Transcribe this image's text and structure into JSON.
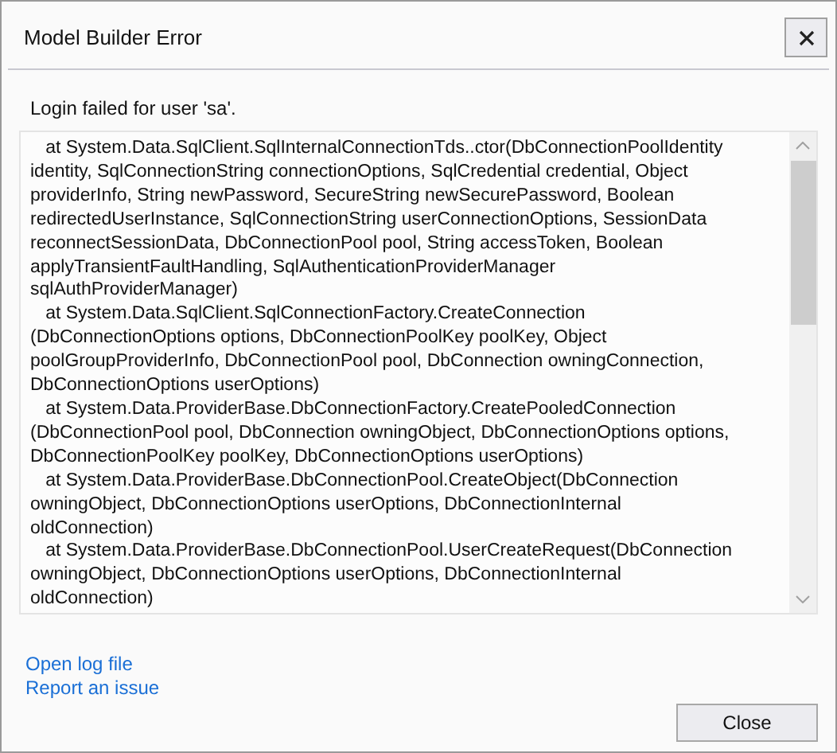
{
  "window": {
    "title": "Model Builder Error"
  },
  "message": "Login failed for user 'sa'.",
  "stack_trace_lines": [
    "   at System.Data.SqlClient.SqlInternalConnectionTds..ctor(DbConnectionPoolIdentity",
    "identity, SqlConnectionString connectionOptions, SqlCredential credential, Object",
    "providerInfo, String newPassword, SecureString newSecurePassword, Boolean",
    "redirectedUserInstance, SqlConnectionString userConnectionOptions, SessionData",
    "reconnectSessionData, DbConnectionPool pool, String accessToken, Boolean",
    "applyTransientFaultHandling, SqlAuthenticationProviderManager",
    "sqlAuthProviderManager)",
    "   at System.Data.SqlClient.SqlConnectionFactory.CreateConnection",
    "(DbConnectionOptions options, DbConnectionPoolKey poolKey, Object",
    "poolGroupProviderInfo, DbConnectionPool pool, DbConnection owningConnection,",
    "DbConnectionOptions userOptions)",
    "   at System.Data.ProviderBase.DbConnectionFactory.CreatePooledConnection",
    "(DbConnectionPool pool, DbConnection owningObject, DbConnectionOptions options,",
    "DbConnectionPoolKey poolKey, DbConnectionOptions userOptions)",
    "   at System.Data.ProviderBase.DbConnectionPool.CreateObject(DbConnection",
    "owningObject, DbConnectionOptions userOptions, DbConnectionInternal",
    "oldConnection)",
    "   at System.Data.ProviderBase.DbConnectionPool.UserCreateRequest(DbConnection",
    "owningObject, DbConnectionOptions userOptions, DbConnectionInternal",
    "oldConnection)"
  ],
  "links": [
    "Open log file",
    "Report an issue"
  ],
  "buttons": [
    "Close"
  ]
}
